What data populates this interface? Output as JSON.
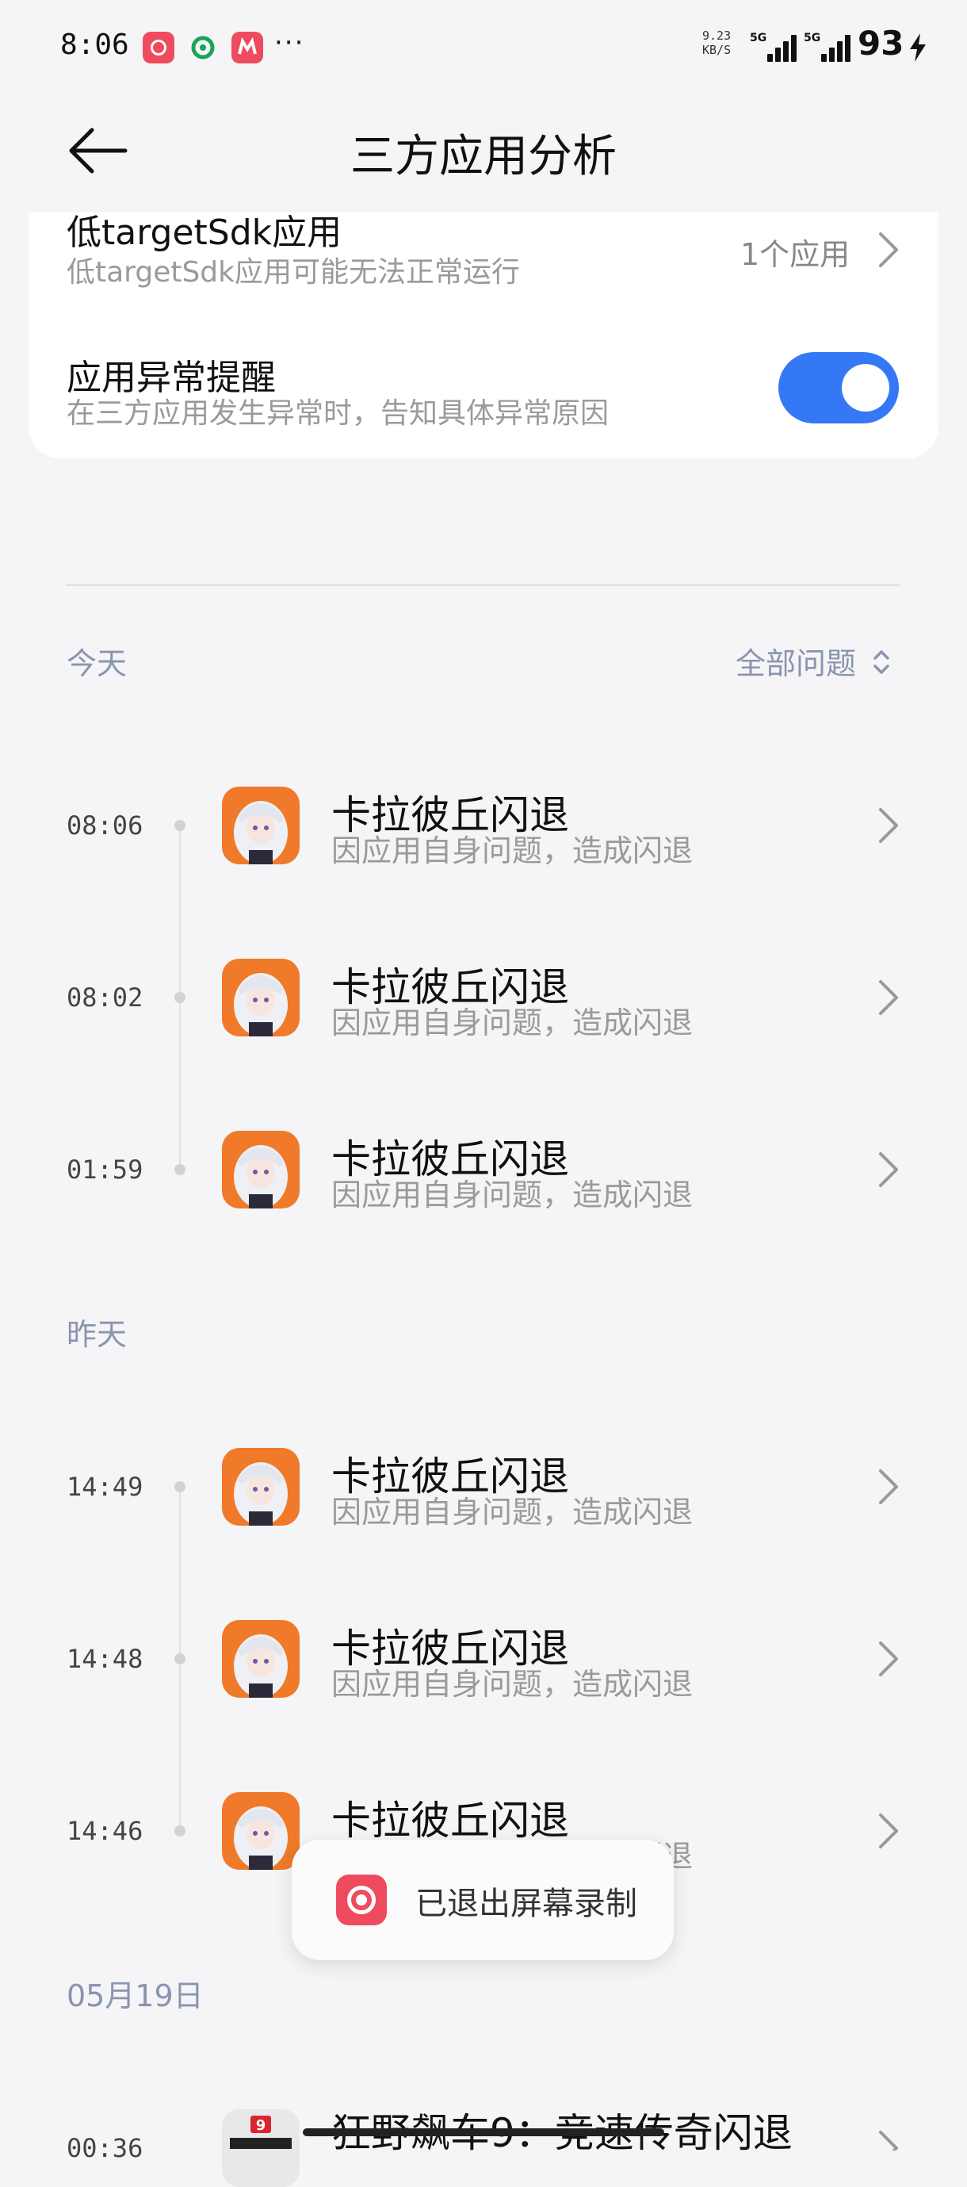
{
  "status_bar": {
    "time": "8:06",
    "more": "···",
    "net_speed_value": "9.23",
    "net_speed_unit": "KB/S",
    "sim1_label": "5G",
    "sim2_label": "5G",
    "battery": "93",
    "charging_icon": "bolt-icon",
    "notification_icons": [
      "screen-record-icon",
      "mobile-carrier-icon",
      "mall-app-icon"
    ]
  },
  "header": {
    "back_icon": "arrow-left-icon",
    "title": "三方应用分析"
  },
  "settings": {
    "low_target": {
      "title": "低targetSdk应用",
      "subtitle": "低targetSdk应用可能无法正常运行",
      "value": "1个应用"
    },
    "abnormal_alert": {
      "title": "应用异常提醒",
      "subtitle": "在三方应用发生异常时，告知具体异常原因",
      "enabled": true,
      "accent": "#3478f6"
    }
  },
  "filter": {
    "label": "全部问题",
    "icon": "chevron-updown-icon"
  },
  "groups": [
    {
      "label": "今天",
      "items": [
        {
          "time": "08:06",
          "title": "卡拉彼丘闪退",
          "subtitle": "因应用自身问题，造成闪退"
        },
        {
          "time": "08:02",
          "title": "卡拉彼丘闪退",
          "subtitle": "因应用自身问题，造成闪退"
        },
        {
          "time": "01:59",
          "title": "卡拉彼丘闪退",
          "subtitle": "因应用自身问题，造成闪退"
        }
      ]
    },
    {
      "label": "昨天",
      "items": [
        {
          "time": "14:49",
          "title": "卡拉彼丘闪退",
          "subtitle": "因应用自身问题，造成闪退"
        },
        {
          "time": "14:48",
          "title": "卡拉彼丘闪退",
          "subtitle": "因应用自身问题，造成闪退"
        },
        {
          "time": "14:46",
          "title": "卡拉彼丘闪退",
          "subtitle": "因应用自身问题，造成闪退"
        }
      ]
    },
    {
      "label": "05月19日",
      "items": [
        {
          "time": "00:36",
          "title": "狂野飙车9：竞速传奇闪退",
          "subtitle": ""
        }
      ]
    }
  ],
  "toast": {
    "icon": "screen-record-icon",
    "text": "已退出屏幕录制",
    "color": "#ef4b5f"
  }
}
